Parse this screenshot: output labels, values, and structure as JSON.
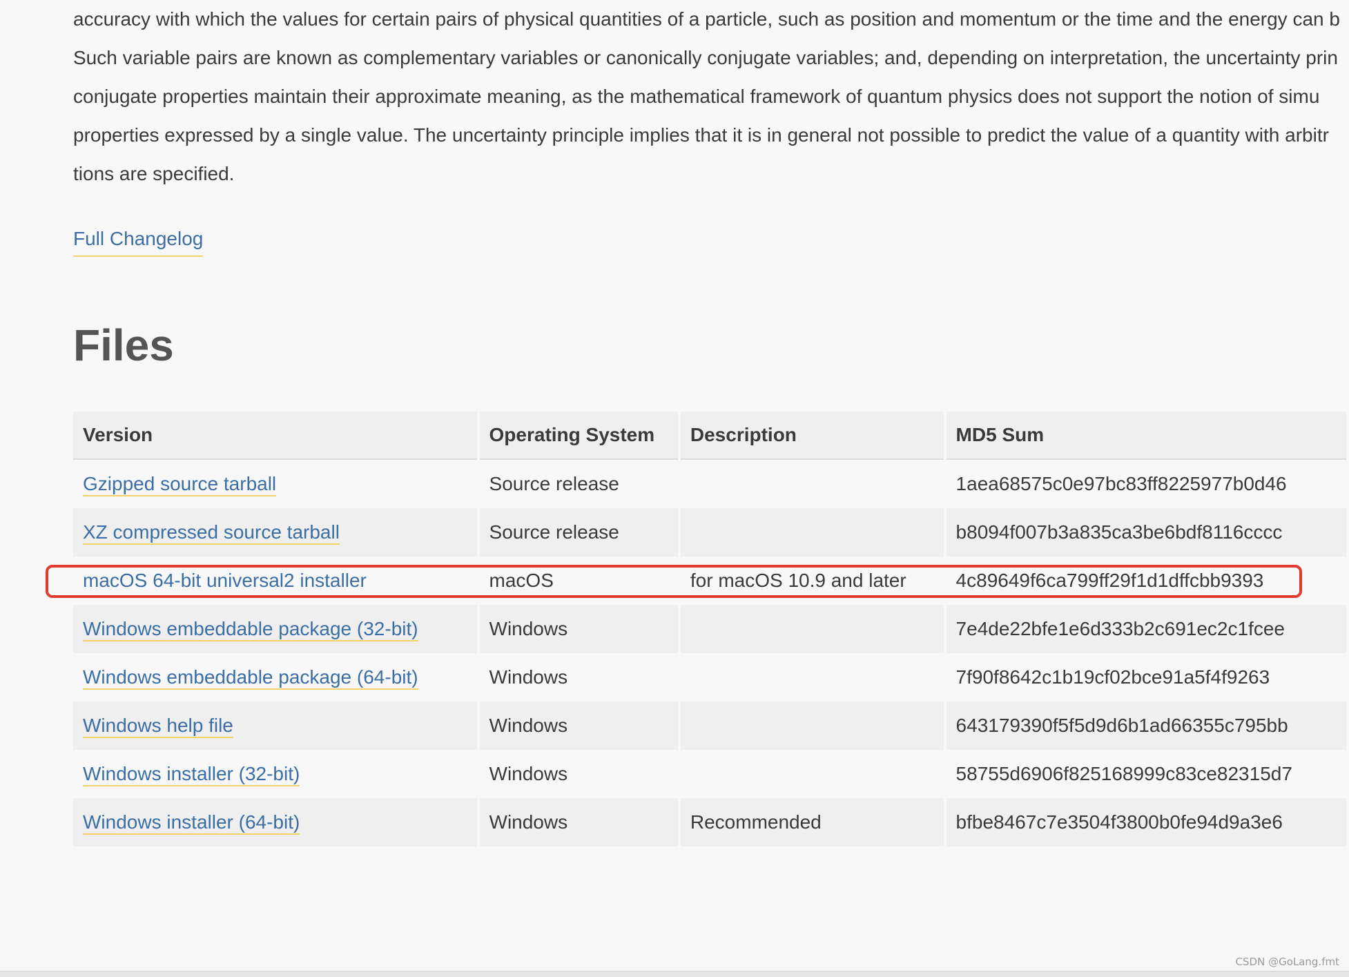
{
  "intro": {
    "lines": [
      "accuracy with which the values for certain pairs of physical quantities of a particle, such as position and momentum or the time and the energy can b",
      "Such variable pairs are known as complementary variables or canonically conjugate variables; and, depending on interpretation, the uncertainty prin",
      "conjugate properties maintain their approximate meaning, as the mathematical framework of quantum physics does not support the notion of simu",
      "properties expressed by a single value. The uncertainty principle implies that it is in general not possible to predict the value of a quantity with arbitr",
      "tions are specified."
    ]
  },
  "changelog_link": "Full Changelog",
  "files": {
    "heading": "Files",
    "columns": {
      "version": "Version",
      "os": "Operating System",
      "description": "Description",
      "md5": "MD5 Sum"
    },
    "rows": [
      {
        "version": "Gzipped source tarball",
        "os": "Source release",
        "description": "",
        "md5": "1aea68575c0e97bc83ff8225977b0d46"
      },
      {
        "version": "XZ compressed source tarball",
        "os": "Source release",
        "description": "",
        "md5": "b8094f007b3a835ca3be6bdf8116cccc"
      },
      {
        "version": "macOS 64-bit universal2 installer",
        "os": "macOS",
        "description": "for macOS 10.9 and later",
        "md5": "4c89649f6ca799ff29f1d1dffcbb9393"
      },
      {
        "version": "Windows embeddable package (32-bit)",
        "os": "Windows",
        "description": "",
        "md5": "7e4de22bfe1e6d333b2c691ec2c1fcee"
      },
      {
        "version": "Windows embeddable package (64-bit)",
        "os": "Windows",
        "description": "",
        "md5": "7f90f8642c1b19cf02bce91a5f4f9263"
      },
      {
        "version": "Windows help file",
        "os": "Windows",
        "description": "",
        "md5": "643179390f5f5d9d6b1ad66355c795bb"
      },
      {
        "version": "Windows installer (32-bit)",
        "os": "Windows",
        "description": "",
        "md5": "58755d6906f825168999c83ce82315d7"
      },
      {
        "version": "Windows installer (64-bit)",
        "os": "Windows",
        "description": "Recommended",
        "md5": "bfbe8467c7e3504f3800b0fe94d9a3e6"
      }
    ]
  },
  "watermark": "CSDN @GoLang.fmt",
  "colors": {
    "link": "#3b6ea5",
    "link_underline": "#f2d46a",
    "highlight": "#e23b2e",
    "background": "#f8f8f8"
  }
}
